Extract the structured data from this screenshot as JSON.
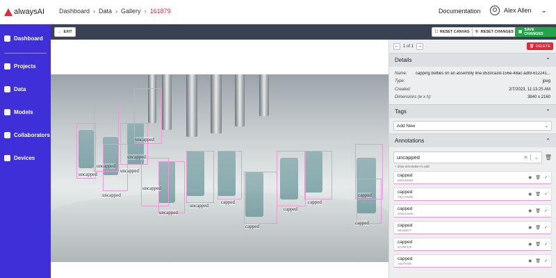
{
  "app": {
    "name": "alwaysAI"
  },
  "breadcrumb": {
    "items": [
      "Dashboard",
      "Data",
      "Gallery"
    ],
    "current": "161879"
  },
  "header": {
    "documentation": "Documentation",
    "user_name": "Alex Allen"
  },
  "sidebar": {
    "items": [
      {
        "label": "Dashboard",
        "icon": "home-icon"
      },
      {
        "label": "Projects",
        "icon": "projects-icon"
      },
      {
        "label": "Data",
        "icon": "data-icon"
      },
      {
        "label": "Models",
        "icon": "models-icon"
      },
      {
        "label": "Collaborators",
        "icon": "collaborators-icon"
      },
      {
        "label": "Devices",
        "icon": "devices-icon"
      }
    ]
  },
  "toolbar": {
    "exit": "EXIT",
    "reset_canvas": "RESET CANVAS",
    "reset_changes": "RESET CHANGES",
    "save_changes": "SAVE CHANGES"
  },
  "panel": {
    "pager": "1 of 1",
    "delete": "DELETE",
    "details": {
      "title": "Details",
      "rows": [
        {
          "key": "Name:",
          "value": "capping bottles on an assembly line.d530ca3d-156e-48ac-adfd-612241..."
        },
        {
          "key": "Type:",
          "value": "jpeg"
        },
        {
          "key": "Created:",
          "value": "2/7/2023, 11:13:25 AM"
        },
        {
          "key": "Dimensions (w x h):",
          "value": "3840 x 2160"
        }
      ]
    },
    "tags": {
      "title": "Tags",
      "select_value": "Add New"
    },
    "annotations": {
      "title": "Annotations",
      "current_label": "uncapped",
      "hint": "+ draw annotation to add",
      "items": [
        {
          "name": "capped",
          "id": "8dd16b084"
        },
        {
          "name": "capped",
          "id": "79177d48b"
        },
        {
          "name": "capped",
          "id": "976614940"
        },
        {
          "name": "capped",
          "id": "96184877"
        },
        {
          "name": "capped",
          "id": "87295329"
        },
        {
          "name": "capped",
          "id": "78479706"
        }
      ]
    }
  },
  "canvas": {
    "labels": {
      "uncapped": "uncapped",
      "capped": "capped"
    }
  },
  "colors": {
    "accent": "#3f2fd9",
    "brand_red": "#e0283c",
    "save_green": "#23a34a",
    "annotation_box": "#e89ad6",
    "toolbar_bg": "#3a4150"
  }
}
